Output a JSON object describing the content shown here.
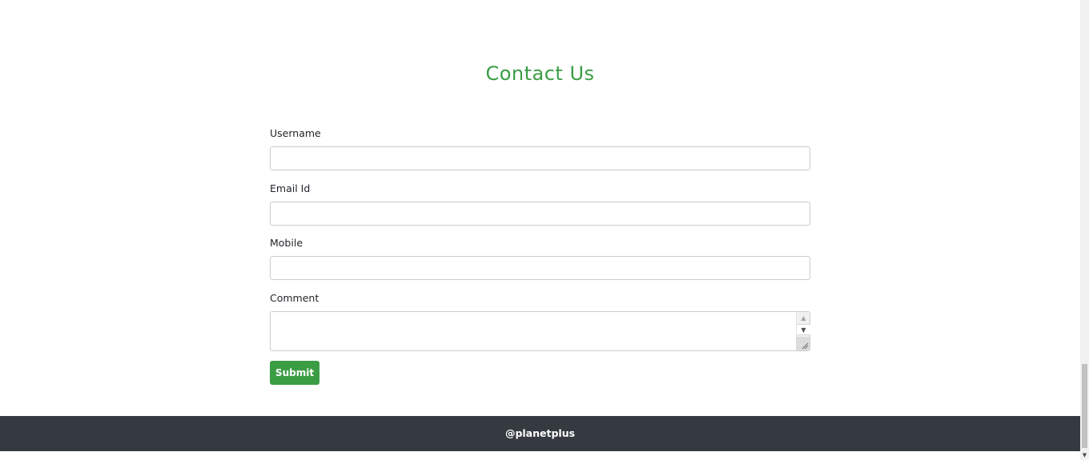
{
  "page": {
    "title": "Contact Us"
  },
  "form": {
    "fields": [
      {
        "label": "Username",
        "value": "",
        "placeholder": ""
      },
      {
        "label": "Email Id",
        "value": "",
        "placeholder": ""
      },
      {
        "label": "Mobile",
        "value": "",
        "placeholder": ""
      }
    ],
    "comment": {
      "label": "Comment",
      "value": ""
    },
    "submit_label": "Submit"
  },
  "footer": {
    "text": "@planetplus"
  },
  "colors": {
    "accent": "#3a9d44",
    "footer_bg": "#343a40"
  },
  "icons": {
    "textarea_up": "scroll-up-arrow",
    "textarea_down": "scroll-down-arrow",
    "textarea_resize": "resize-grip",
    "page_scroll_down": "scroll-down-arrow"
  }
}
